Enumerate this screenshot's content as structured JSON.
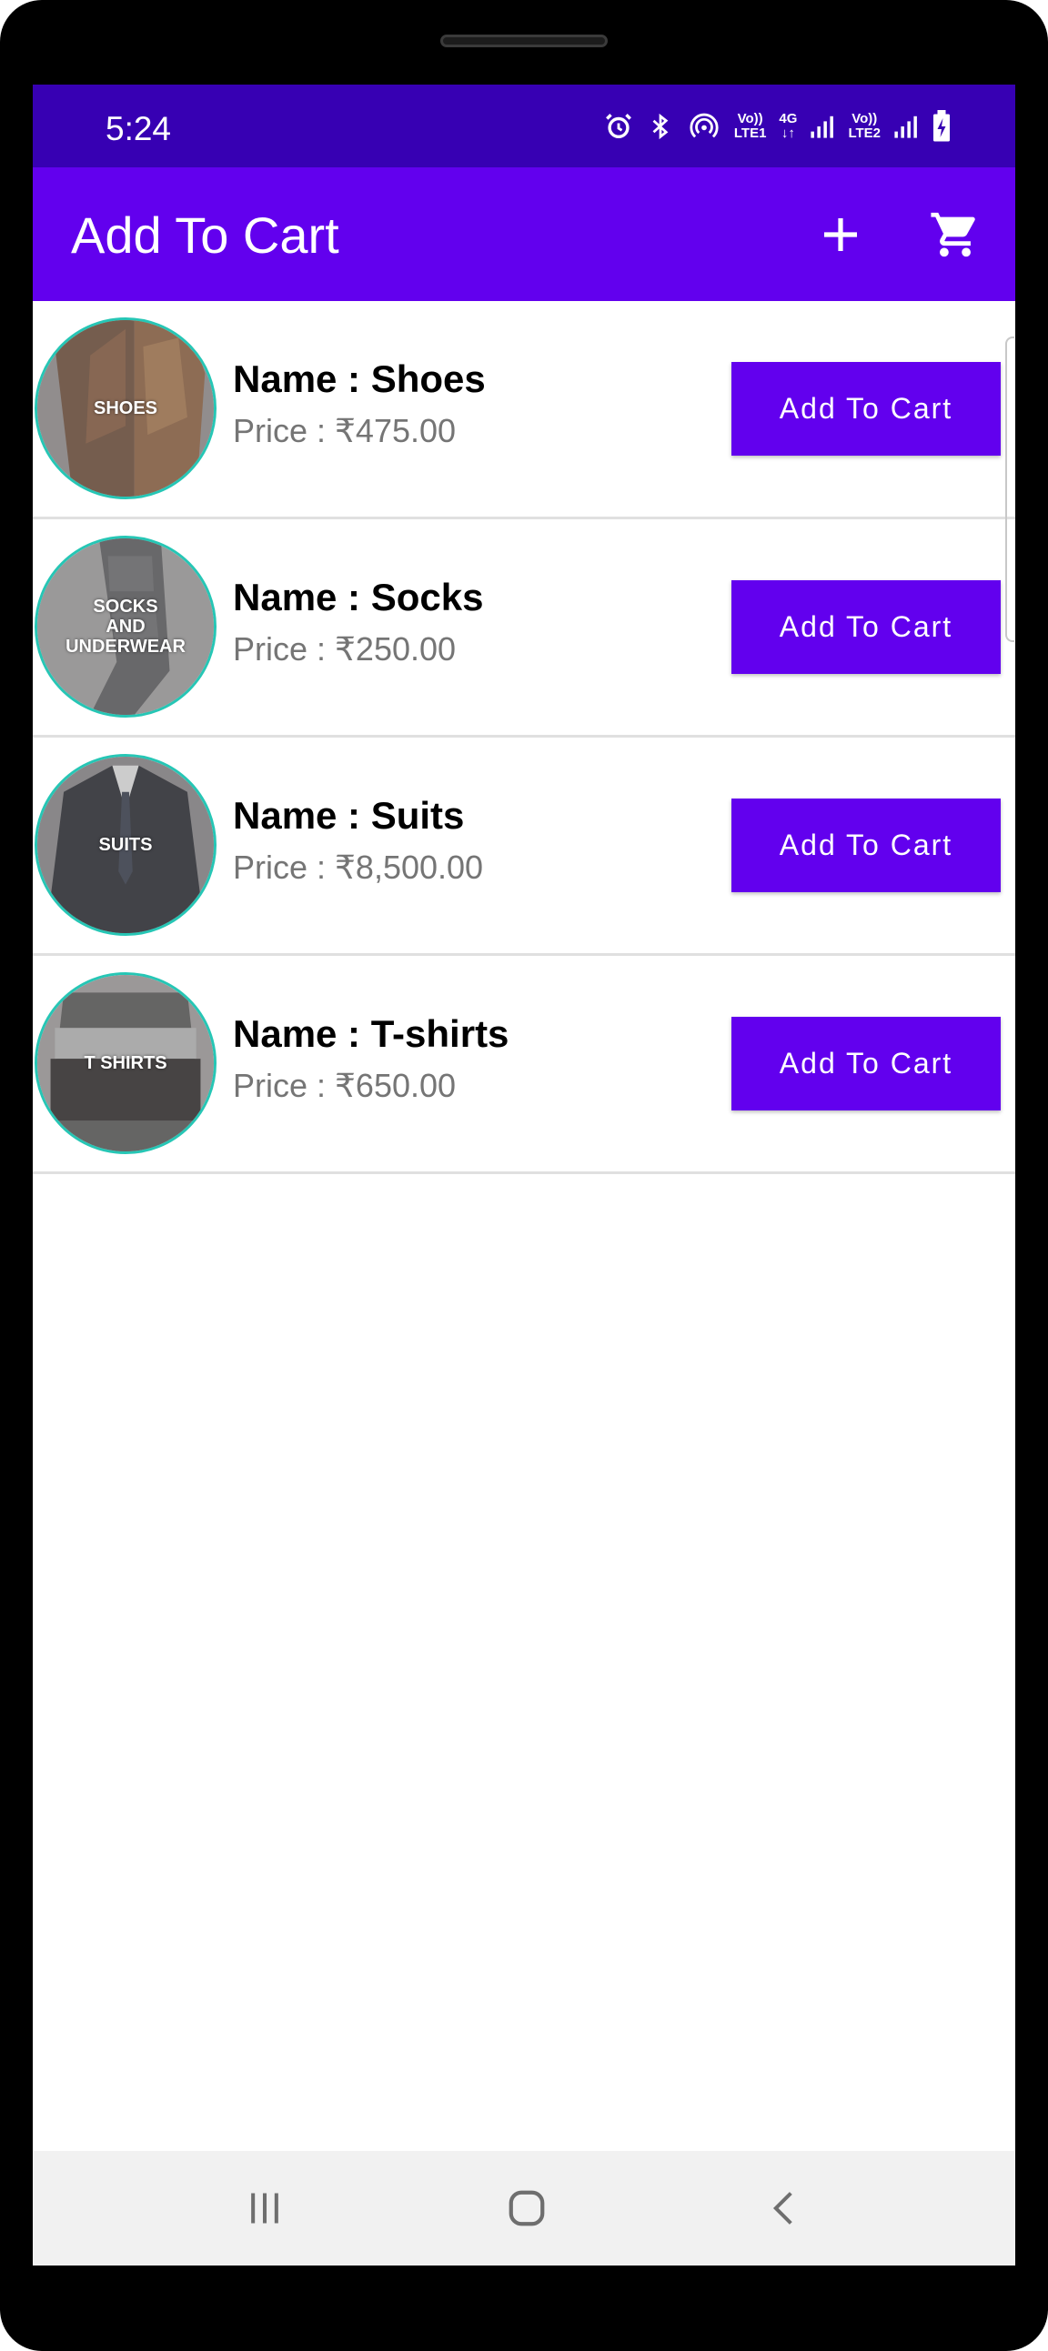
{
  "status_bar": {
    "time": "5:24",
    "icons": [
      "alarm-icon",
      "bluetooth-icon",
      "hotspot-icon",
      "volte-lte1-icon",
      "4g-data-icon",
      "signal-icon",
      "volte-lte2-icon",
      "signal-icon",
      "battery-charging-icon"
    ],
    "sim1_top": "Vo))",
    "sim1_bottom": "LTE1",
    "data_type": "4G",
    "sim2_top": "Vo))",
    "sim2_bottom": "LTE2"
  },
  "app_bar": {
    "title": "Add To Cart",
    "actions": [
      "add-icon",
      "cart-icon"
    ]
  },
  "products": [
    {
      "image_label": "SHOES",
      "name": "Name : Shoes",
      "price": "Price : ₹475.00",
      "button": "Add To Cart"
    },
    {
      "image_label": "SOCKS\nAND\nUNDERWEAR",
      "name": "Name : Socks",
      "price": "Price : ₹250.00",
      "button": "Add To Cart"
    },
    {
      "image_label": "SUITS",
      "name": "Name : Suits",
      "price": "Price : ₹8,500.00",
      "button": "Add To Cart"
    },
    {
      "image_label": "T SHIRTS",
      "name": "Name : T-shirts",
      "price": "Price : ₹650.00",
      "button": "Add To Cart"
    }
  ],
  "nav_bar": {
    "buttons": [
      "recents-icon",
      "home-icon",
      "back-icon"
    ]
  },
  "colors": {
    "status_bar": "#3700b3",
    "primary": "#6200ee",
    "avatar_border": "#26c6b5",
    "price_text": "#757575",
    "nav_bar": "#f1f1f1"
  }
}
